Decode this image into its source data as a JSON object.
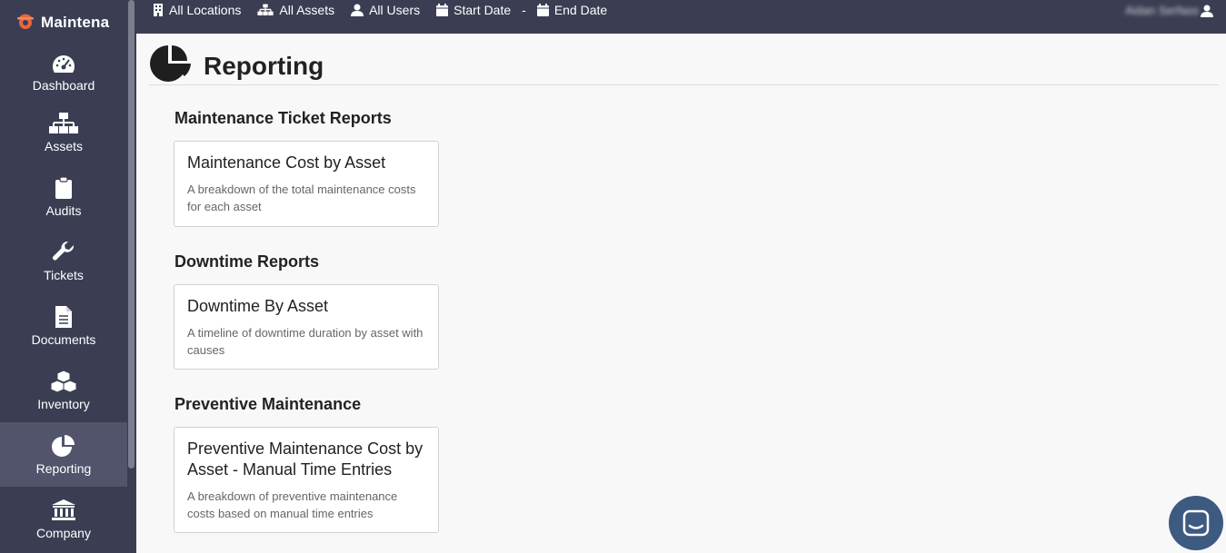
{
  "app": {
    "brand": "Maintena"
  },
  "sidebar": {
    "items": [
      {
        "label": "Dashboard"
      },
      {
        "label": "Assets"
      },
      {
        "label": "Audits"
      },
      {
        "label": "Tickets"
      },
      {
        "label": "Documents"
      },
      {
        "label": "Inventory"
      },
      {
        "label": "Reporting"
      },
      {
        "label": "Company"
      }
    ],
    "active": "Reporting"
  },
  "topbar": {
    "locations": "All Locations",
    "assets": "All Assets",
    "users": "All Users",
    "start_date": "Start Date",
    "separator": "-",
    "end_date": "End Date",
    "user_name": "Aidan Serfass"
  },
  "page": {
    "title": "Reporting"
  },
  "sections": [
    {
      "title": "Maintenance Ticket Reports",
      "card": {
        "title": "Maintenance Cost by Asset",
        "desc": "A breakdown of the total maintenance costs for each asset"
      }
    },
    {
      "title": "Downtime Reports",
      "card": {
        "title": "Downtime By Asset",
        "desc": "A timeline of downtime duration by asset with causes"
      }
    },
    {
      "title": "Preventive Maintenance",
      "card": {
        "title": "Preventive Maintenance Cost by Asset - Manual Time Entries",
        "desc": "A breakdown of preventive maintenance costs based on manual time entries"
      }
    }
  ],
  "colors": {
    "sidebar": "#3b3e53",
    "active": "#51546a",
    "accent": "#e8663d",
    "chat": "#3d5a80"
  },
  "icons": {
    "brand": "gear-helmet-icon",
    "dashboard": "gauge-icon",
    "assets": "sitemap-icon",
    "audits": "clipboard-icon",
    "tickets": "wrench-icon",
    "documents": "file-icon",
    "inventory": "cubes-icon",
    "reporting": "pie-chart-icon",
    "company": "bank-icon",
    "chat": "chat-icon"
  }
}
